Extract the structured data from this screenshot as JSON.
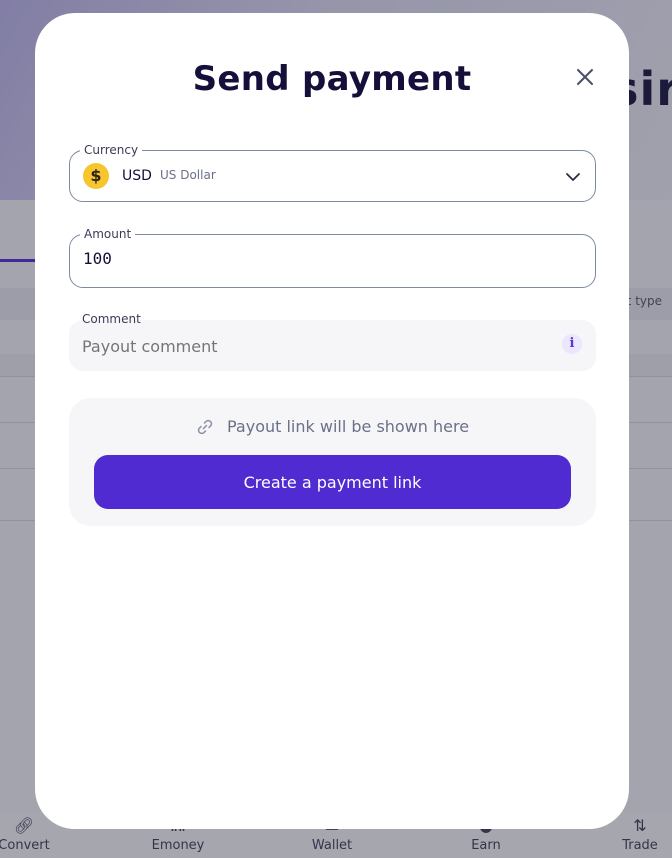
{
  "background": {
    "title_fragment": "sir",
    "column_label": "t type",
    "nav": [
      {
        "label": "Convert",
        "icon": "convert-icon"
      },
      {
        "label": "Emoney",
        "icon": "bank-icon"
      },
      {
        "label": "Wallet",
        "icon": "wallet-icon"
      },
      {
        "label": "Earn",
        "icon": "earn-icon"
      },
      {
        "label": "Trade",
        "icon": "trade-icon"
      }
    ]
  },
  "modal": {
    "title": "Send payment",
    "close_icon": "close-icon",
    "currency": {
      "legend": "Currency",
      "icon": "dollar-coin-icon",
      "coin_symbol": "$",
      "code": "USD",
      "name": "US Dollar",
      "chevron_icon": "chevron-down-icon"
    },
    "amount": {
      "legend": "Amount",
      "value": "100"
    },
    "comment": {
      "legend": "Comment",
      "placeholder": "Payout comment",
      "info_icon": "info-icon",
      "info_glyph": "i"
    },
    "link_panel": {
      "icon": "link-icon",
      "text": "Payout link will be shown here",
      "button_label": "Create a payment link"
    }
  },
  "colors": {
    "accent": "#4f2bd1",
    "title": "#14103a",
    "coin": "#f7c62f"
  }
}
